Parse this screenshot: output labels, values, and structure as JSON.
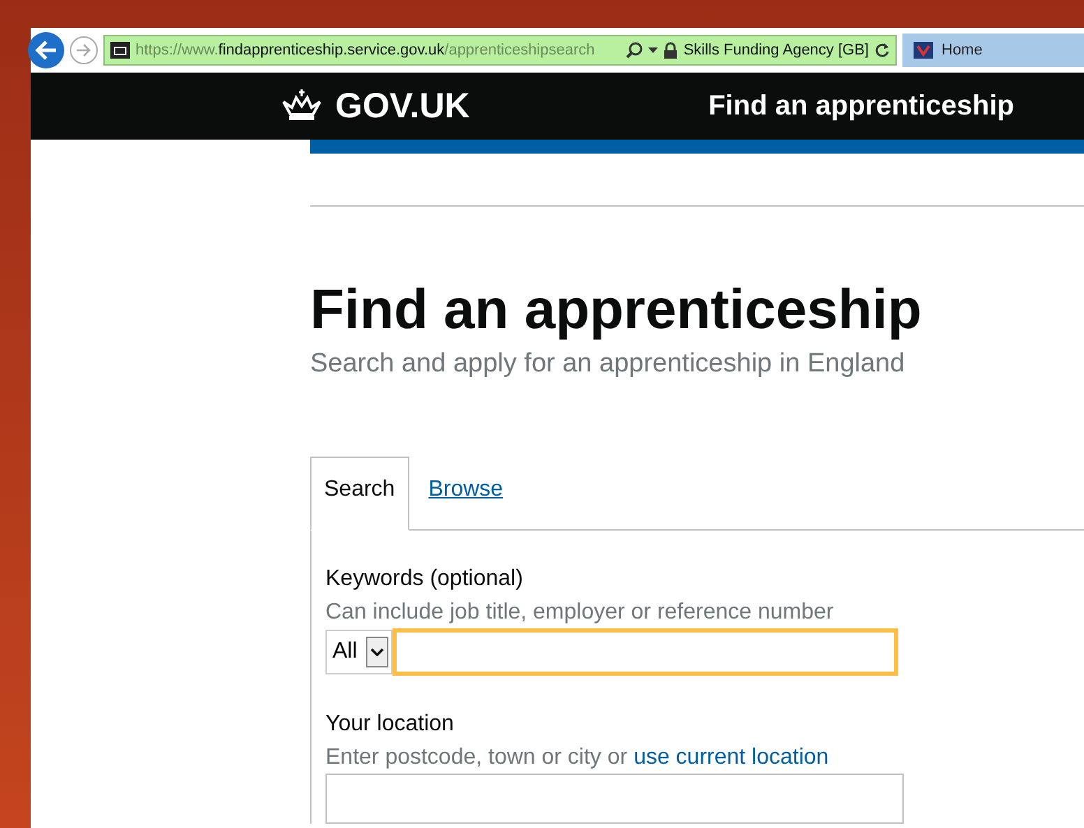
{
  "browser": {
    "url": {
      "scheme": "https://www.",
      "domain": "findapprenticeship.service.gov.uk",
      "path": "/apprenticeshipsearch"
    },
    "site_identity": "Skills Funding Agency [GB]",
    "tabs": [
      {
        "label": "Home",
        "selected": false
      }
    ]
  },
  "header": {
    "logo": "GOV.UK",
    "service": "Find an apprenticeship"
  },
  "page": {
    "title": "Find an apprenticeship",
    "subtitle": "Search and apply for an apprenticeship in England"
  },
  "tabs": [
    {
      "label": "Search",
      "selected": true
    },
    {
      "label": "Browse",
      "selected": false
    }
  ],
  "keywords": {
    "label": "Keywords (optional)",
    "hint": "Can include job title, employer or reference number",
    "scope": "All",
    "focused": true
  },
  "location": {
    "label": "Your location",
    "hint": "Enter postcode, town or city or",
    "link": "use current location"
  }
}
